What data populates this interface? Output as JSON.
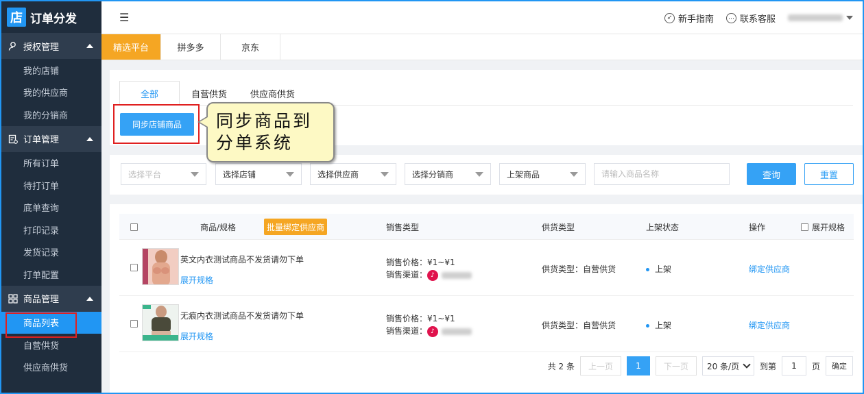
{
  "app": {
    "logo_char": "店",
    "title": "订单分发"
  },
  "header": {
    "menu_icon": "☰",
    "guide": "新手指南",
    "support": "联系客服"
  },
  "sidebar": {
    "groups": [
      {
        "title": "授权管理",
        "items": [
          "我的店铺",
          "我的供应商",
          "我的分销商"
        ]
      },
      {
        "title": "订单管理",
        "items": [
          "所有订单",
          "待打订单",
          "底单查询",
          "打印记录",
          "发货记录",
          "打单配置"
        ]
      },
      {
        "title": "商品管理",
        "items": [
          "商品列表",
          "自营供货",
          "供应商供货"
        ]
      }
    ],
    "active_item": "商品列表"
  },
  "platform_tabs": [
    "精选平台",
    "拼多多",
    "京东"
  ],
  "supply_tabs": [
    "全部",
    "自营供货",
    "供应商供货"
  ],
  "sync_button": "同步店铺商品",
  "callout": {
    "line1": "同步商品到",
    "line2": "分单系统"
  },
  "filters": {
    "platform": "选择平台",
    "shop": "选择店铺",
    "supplier": "选择供应商",
    "distributor": "选择分销商",
    "listing": "上架商品",
    "name_placeholder": "请输入商品名称",
    "query": "查询",
    "reset": "重置"
  },
  "table": {
    "headers": {
      "product": "商品/规格",
      "bind_batch": "批量绑定供应商",
      "sales_type": "销售类型",
      "supply_type": "供货类型",
      "status": "上架状态",
      "action": "操作",
      "expand_all": "展开规格"
    },
    "rows": [
      {
        "name": "英文内衣测试商品不发货请勿下单",
        "expand": "展开规格",
        "price_label": "销售价格：",
        "price": "¥1~¥1",
        "channel_label": "销售渠道：",
        "supply": "供货类型：自营供货",
        "status": "上架",
        "action": "绑定供应商"
      },
      {
        "name": "无痕内衣测试商品不发货请勿下单",
        "expand": "展开规格",
        "price_label": "销售价格：",
        "price": "¥1~¥1",
        "channel_label": "销售渠道：",
        "supply": "供货类型：自营供货",
        "status": "上架",
        "action": "绑定供应商"
      }
    ]
  },
  "pagination": {
    "total": "共 2 条",
    "prev": "上一页",
    "current": "1",
    "next": "下一页",
    "page_size": "20 条/页",
    "goto": "到第",
    "goto_value": "1",
    "page_unit": "页",
    "confirm": "确定"
  },
  "colors": {
    "accent": "#2196f3",
    "orange": "#f5a623",
    "sidebar": "#1f2d3d",
    "highlight": "#e02020"
  }
}
